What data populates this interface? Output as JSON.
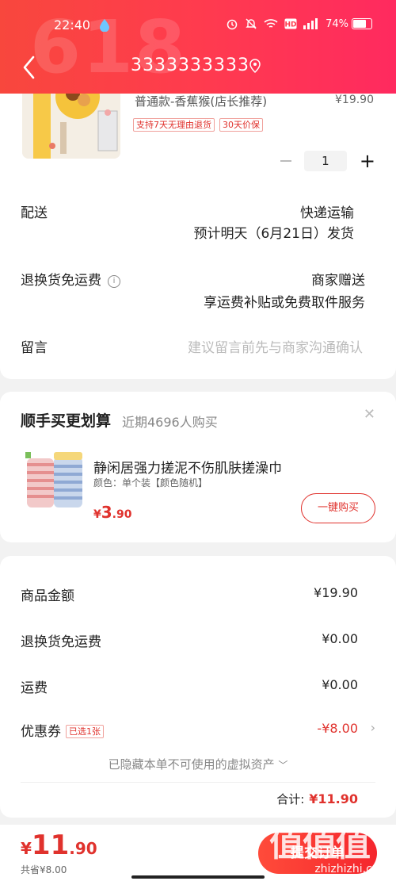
{
  "status_bar": {
    "time": "22:40",
    "battery": "74%",
    "battery_level": 0.74
  },
  "header": {
    "bg_text": "618",
    "title": "3333333333"
  },
  "product": {
    "spec": "普通款-香蕉猴(店长推荐)",
    "price": "¥19.90",
    "tags": [
      "支持7天无理由退货",
      "30天价保"
    ],
    "quantity": "1"
  },
  "delivery": {
    "label": "配送",
    "method": "快递运输",
    "eta": "预计明天（6月21日）发货"
  },
  "return_shipping": {
    "label": "退换货免运费",
    "value": "商家赠送",
    "desc": "享运费补贴或免费取件服务"
  },
  "message": {
    "label": "留言",
    "placeholder": "建议留言前先与商家沟通确认"
  },
  "upsell": {
    "title": "顺手买更划算",
    "subtitle": "近期4696人购买",
    "item_name": "静闲居强力搓泥不伤肌肤搓澡巾",
    "variant": "颜色：单个装【颜色随机】",
    "price_yen": "¥",
    "price_int": "3",
    "price_dec": ".90",
    "buy_label": "一键购买"
  },
  "summary": {
    "goods_label": "商品金额",
    "goods_value": "¥19.90",
    "return_label": "退换货免运费",
    "return_value": "¥0.00",
    "shipping_label": "运费",
    "shipping_value": "¥0.00",
    "coupon_label": "优惠券",
    "coupon_tag": "已选1张",
    "coupon_value": "-¥8.00",
    "hidden_note": "已隐藏本单不可使用的虚拟资产",
    "total_label": "合计:",
    "total_value": "¥11.90"
  },
  "bottom": {
    "yen": "¥",
    "int": "11",
    "dec": ".90",
    "saved": "共省¥8.00",
    "submit_label": "提交订单"
  },
  "watermark": {
    "text": "值值值",
    "url": "zhizhizhi.com"
  },
  "colors": {
    "accent": "#e0322d",
    "header": "#ff3b4e"
  }
}
